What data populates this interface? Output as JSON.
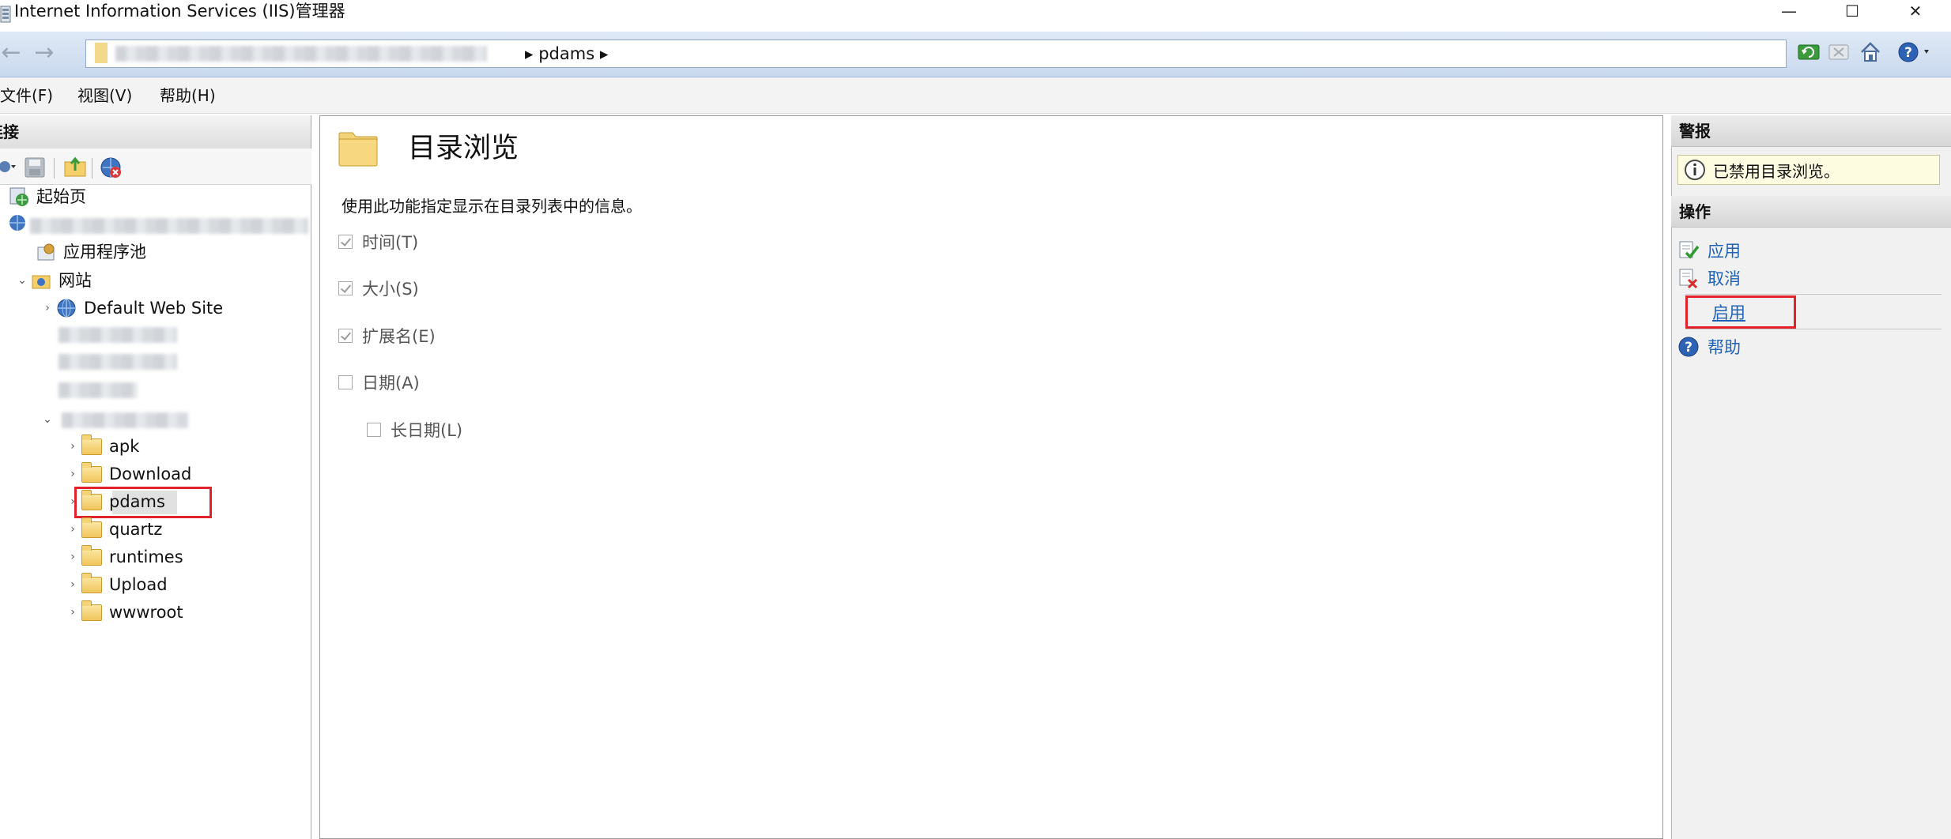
{
  "window": {
    "title": "Internet Information Services (IIS)管理器",
    "minimize_glyph": "—",
    "maximize_glyph": "☐",
    "close_glyph": "✕"
  },
  "address_bar": {
    "breadcrumb": "▸ pdams ▸",
    "back_glyph": "←",
    "forward_glyph": "→"
  },
  "menu": {
    "file": "文件(F)",
    "view": "视图(V)",
    "help": "帮助(H)"
  },
  "connections": {
    "header": "连接",
    "tree": {
      "start_page": "起始页",
      "app_pools": "应用程序池",
      "sites": "网站",
      "default_site": "Default Web Site",
      "folders": [
        "apk",
        "Download",
        "pdams",
        "quartz",
        "runtimes",
        "Upload",
        "wwwroot"
      ],
      "selected_folder": "pdams"
    }
  },
  "feature": {
    "title": "目录浏览",
    "description": "使用此功能指定显示在目录列表中的信息。",
    "options": [
      {
        "label": "时间(T)",
        "checked": true
      },
      {
        "label": "大小(S)",
        "checked": true
      },
      {
        "label": "扩展名(E)",
        "checked": true
      },
      {
        "label": "日期(A)",
        "checked": false
      }
    ],
    "sub_option": {
      "label": "长日期(L)",
      "checked": false
    }
  },
  "alerts": {
    "header": "警报",
    "message": "已禁用目录浏览。"
  },
  "actions": {
    "header": "操作",
    "apply": "应用",
    "cancel": "取消",
    "enable": "启用",
    "help": "帮助"
  },
  "colors": {
    "accent_link": "#1f62b6",
    "highlight_red": "#e0222a"
  }
}
